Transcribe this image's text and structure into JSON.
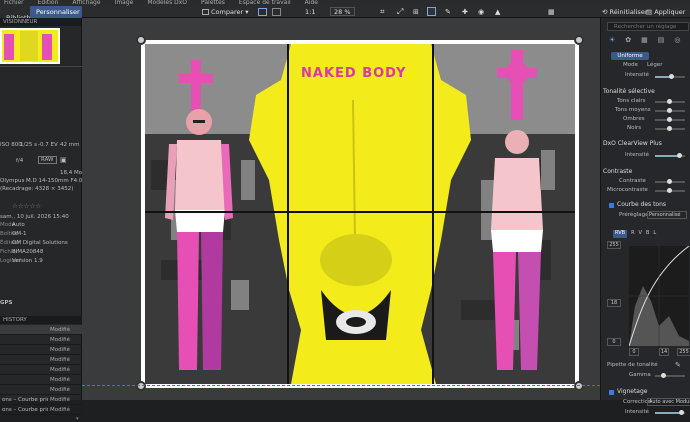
{
  "menu": [
    "Fichier",
    "Édition",
    "Affichage",
    "Image",
    "Modèles DxO",
    "Palettes",
    "Espace de travail",
    "Aide"
  ],
  "toolbar": {
    "tab_left": "Bibliothèque",
    "tab_active": "Personnaliser",
    "compare": "Comparer",
    "zoom_1to1": "1:1",
    "zoom_level": "28 %",
    "reset": "Réinitialiser",
    "apply": "Appliquer u"
  },
  "left_panel": {
    "preview_header": "VISIONNEUR",
    "info": {
      "iso": "ISO 800",
      "shutter": "1/25 s",
      "ev": "-0.7 EV",
      "focal": "42 mm",
      "aperture": "f/4",
      "format": "RAW",
      "filesize": "18,4 Mo",
      "lens": "Olympus M.D 14-150mm F4.0-5.6 II",
      "crop": "(Recadrage: 4328 × 3452)",
      "rating": "☆☆☆☆☆",
      "date": "sam., 10 juil. 2026 15:40",
      "mode_label": "Mode",
      "mode": "Auto",
      "camera_label": "Boîtier",
      "camera": "OM-1",
      "editor_label": "Éditeur",
      "editor": "OM Digital Solutions",
      "file_label": "Fichier",
      "file": "BIMA20848",
      "version_label": "Logiciel",
      "version": "Version 1.9",
      "gps": "GPS"
    },
    "history_header": "HISTORY",
    "history": [
      {
        "label": "",
        "status": "Modifié"
      },
      {
        "label": "",
        "status": "Modifié"
      },
      {
        "label": "",
        "status": "Modifié"
      },
      {
        "label": "",
        "status": "Modifié"
      },
      {
        "label": "",
        "status": "Modifié"
      },
      {
        "label": "",
        "status": "Modifié"
      },
      {
        "label": "",
        "status": "Modifié"
      },
      {
        "label": "ons – Courbe princ...",
        "status": "Modifié"
      },
      {
        "label": "ons – Courbe princ...",
        "status": "Modifié"
      }
    ]
  },
  "artwork": {
    "title_part1": "NAKED",
    "title_part2": "BODY",
    "colors": {
      "yellow": "#f3ec1a",
      "magenta": "#e64fb4",
      "dark": "#1a1a1a"
    }
  },
  "right_panel": {
    "search_placeholder": "Rechercher un réglage",
    "uniforme": "Uniforme",
    "mode_label": "Mode",
    "mode_value": "Léger",
    "intensity_label": "Intensité",
    "tonalite_header": "Tonalité sélective",
    "tonalite": [
      "Tons clairs",
      "Tons moyens",
      "Ombres",
      "Noirs"
    ],
    "clearview_header": "DxO ClearView Plus",
    "clearview_intensity": "Intensité",
    "contrast_header": "Contraste",
    "contrast_rows": [
      "Contraste",
      "Microcontraste"
    ],
    "curve_header": "Courbe des tons",
    "preset_label": "Préréglage",
    "preset_value": "Personnalisé",
    "channels": [
      "RVB",
      "R",
      "V",
      "B",
      "L"
    ],
    "curve_top": "255",
    "curve_mid": "18",
    "curve_zero": "0",
    "curve_x14": "14",
    "curve_x255": "255",
    "pipette": "Pipette de tonalité",
    "gamma": "Gamma",
    "vignette_header": "Vignetage",
    "correction_label": "Correction",
    "correction_value": "Auto avec Module",
    "vignette_intensity": "Intensité"
  }
}
